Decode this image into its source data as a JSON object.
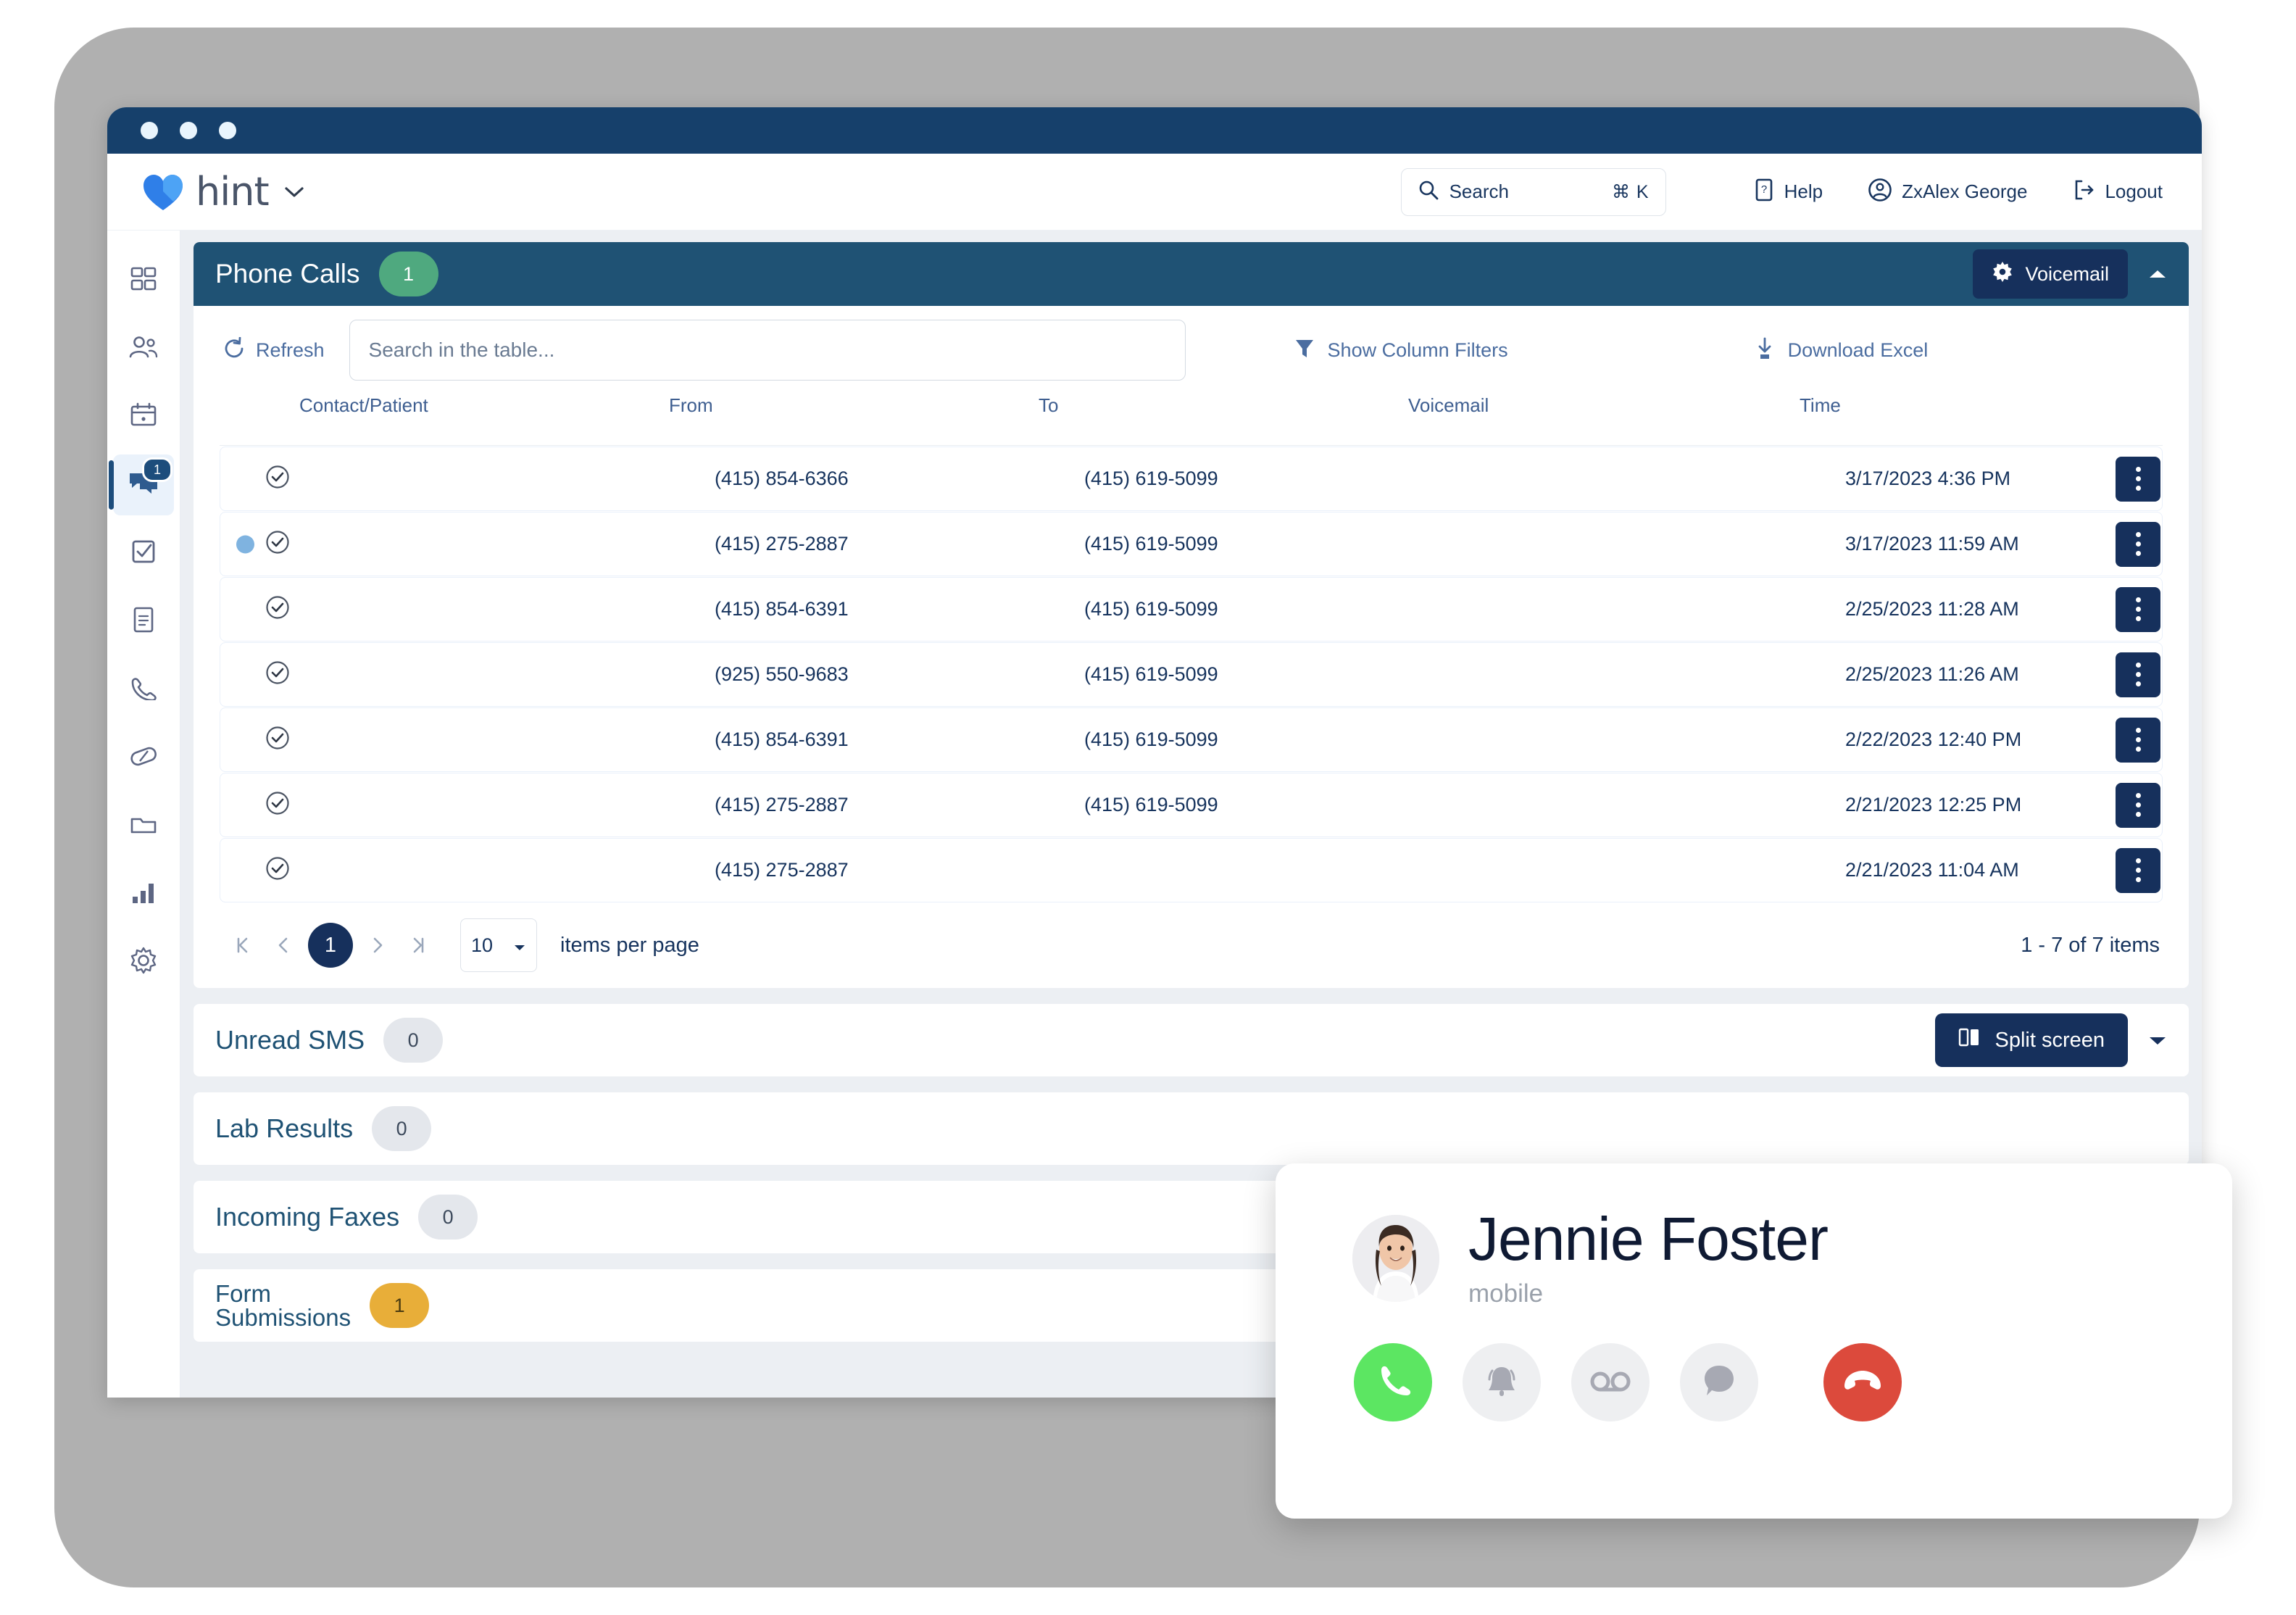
{
  "window": {
    "title_dots": 3
  },
  "brand": {
    "name": "hint",
    "caret": "chevron-down"
  },
  "topnav": {
    "search_placeholder": "Search",
    "search_shortcut": "⌘ K",
    "help_label": "Help",
    "user_label": "ZxAlex George",
    "logout_label": "Logout"
  },
  "sidebar": {
    "items": [
      {
        "name": "dashboard",
        "icon": "grid-icon",
        "badge": null,
        "active": false
      },
      {
        "name": "patients",
        "icon": "people-icon",
        "badge": null,
        "active": false
      },
      {
        "name": "calendar",
        "icon": "calendar-icon",
        "badge": null,
        "active": false
      },
      {
        "name": "messages",
        "icon": "chat-icon",
        "badge": "1",
        "active": true
      },
      {
        "name": "tasks",
        "icon": "checkbox-icon",
        "badge": null,
        "active": false
      },
      {
        "name": "documents",
        "icon": "document-icon",
        "badge": null,
        "active": false
      },
      {
        "name": "calls",
        "icon": "phone-icon",
        "badge": null,
        "active": false
      },
      {
        "name": "medications",
        "icon": "pill-icon",
        "badge": null,
        "active": false
      },
      {
        "name": "files",
        "icon": "folder-icon",
        "badge": null,
        "active": false
      },
      {
        "name": "reports",
        "icon": "bar-chart-icon",
        "badge": null,
        "active": false
      },
      {
        "name": "settings",
        "icon": "gear-icon",
        "badge": null,
        "active": false
      }
    ]
  },
  "panel": {
    "title": "Phone Calls",
    "count": "1",
    "voicemail_label": "Voicemail",
    "collapse_icon": "chevron-up"
  },
  "toolbar": {
    "refresh_label": "Refresh",
    "search_placeholder": "Search in the table...",
    "search_value": "",
    "filters_label": "Show Column Filters",
    "download_label": "Download Excel"
  },
  "table": {
    "columns": [
      "Contact/Patient",
      "From",
      "To",
      "Voicemail",
      "Time"
    ],
    "rows": [
      {
        "unread": false,
        "contact": "",
        "from": "(415) 854-6366",
        "to": "(415) 619-5099",
        "voicemail": "",
        "time": "3/17/2023 4:36 PM"
      },
      {
        "unread": true,
        "contact": "",
        "from": "(415) 275-2887",
        "to": "(415) 619-5099",
        "voicemail": "",
        "time": "3/17/2023 11:59 AM"
      },
      {
        "unread": false,
        "contact": "",
        "from": "(415) 854-6391",
        "to": "(415) 619-5099",
        "voicemail": "",
        "time": "2/25/2023 11:28 AM"
      },
      {
        "unread": false,
        "contact": "",
        "from": "(925) 550-9683",
        "to": "(415) 619-5099",
        "voicemail": "",
        "time": "2/25/2023 11:26 AM"
      },
      {
        "unread": false,
        "contact": "",
        "from": "(415) 854-6391",
        "to": "(415) 619-5099",
        "voicemail": "",
        "time": "2/22/2023 12:40 PM"
      },
      {
        "unread": false,
        "contact": "",
        "from": "(415) 275-2887",
        "to": "(415) 619-5099",
        "voicemail": "",
        "time": "2/21/2023 12:25 PM"
      },
      {
        "unread": false,
        "contact": "",
        "from": "(415) 275-2887",
        "to": "",
        "voicemail": "",
        "time": "2/21/2023 11:04 AM"
      }
    ]
  },
  "pager": {
    "first": "⏮",
    "prev": "◂",
    "current_page": "1",
    "next": "▸",
    "last": "⏭",
    "per_page_value": "10",
    "per_page_label": "items per page",
    "summary": "1 - 7 of 7 items"
  },
  "accordions": [
    {
      "title": "Unread SMS",
      "count": "0",
      "badge_style": "gray"
    },
    {
      "title": "Lab Results",
      "count": "0",
      "badge_style": "gray"
    },
    {
      "title": "Incoming Faxes",
      "count": "0",
      "badge_style": "gray"
    },
    {
      "title": "Form Submissions",
      "count": "1",
      "badge_style": "amber"
    }
  ],
  "split": {
    "label": "Split screen",
    "caret": "chevron-down"
  },
  "call_card": {
    "caller_name": "Jennie Foster",
    "caller_line_type": "mobile",
    "actions": [
      {
        "name": "answer-call",
        "icon": "phone-icon"
      },
      {
        "name": "silence-ring",
        "icon": "bell-icon"
      },
      {
        "name": "send-voicemail",
        "icon": "voicemail-icon"
      },
      {
        "name": "send-message",
        "icon": "chat-bubble-icon"
      },
      {
        "name": "decline-call",
        "icon": "phone-hangup-icon"
      }
    ]
  },
  "colors": {
    "navy": "#16305c",
    "panel_header": "#1f5274",
    "title_bar": "#16406b",
    "brand_blue": "#2f7fe8",
    "green_badge": "#4fa97f",
    "amber_badge": "#e8ae39",
    "answer_green": "#5ce662",
    "decline_red": "#dc4a3c",
    "page_bg": "#eceff3",
    "bezel_gray": "#b0b0b0"
  }
}
